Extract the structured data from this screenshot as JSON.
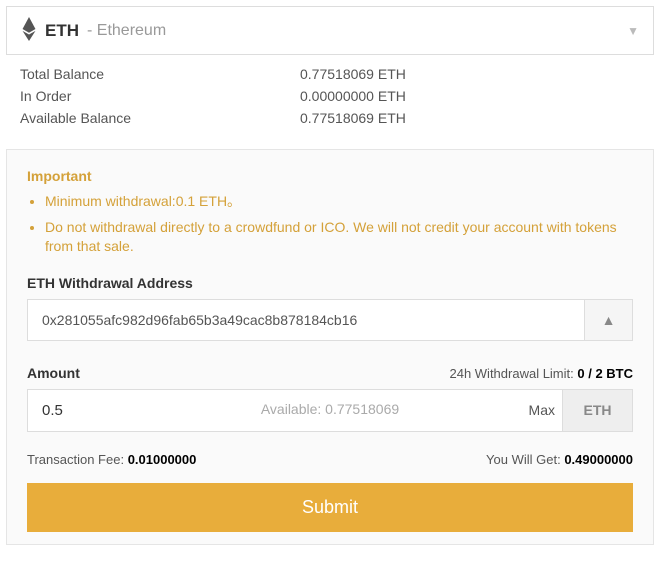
{
  "selector": {
    "symbol": "ETH",
    "name": "- Ethereum"
  },
  "balances": {
    "total_label": "Total Balance",
    "total_value": "0.77518069 ETH",
    "inorder_label": "In Order",
    "inorder_value": "0.00000000 ETH",
    "available_label": "Available Balance",
    "available_value": "0.77518069 ETH"
  },
  "important": {
    "title": "Important",
    "line1": "Minimum withdrawal:0.1 ETH。",
    "line2": "Do not withdrawal directly to a crowdfund or ICO. We will not credit your account with tokens from that sale."
  },
  "address": {
    "label": "ETH Withdrawal Address",
    "value": "0x281055afc982d96fab65b3a49cac8b878184cb16"
  },
  "amount": {
    "label": "Amount",
    "limit_prefix": "24h Withdrawal Limit: ",
    "limit_value": "0 / 2 BTC",
    "value": "0.5",
    "available_hint": "Available: 0.77518069",
    "max_label": "Max",
    "unit": "ETH"
  },
  "fee": {
    "fee_label": "Transaction Fee: ",
    "fee_value": "0.01000000",
    "get_label": "You Will Get: ",
    "get_value": "0.49000000"
  },
  "submit_label": "Submit"
}
